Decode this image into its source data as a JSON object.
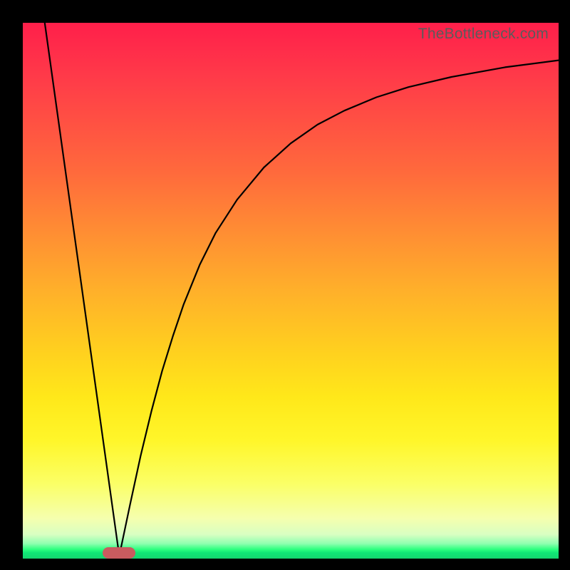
{
  "watermark": "TheBottleneck.com",
  "colors": {
    "frame": "#000000",
    "watermark_text": "#5b5b5b",
    "marker": "#c95b5f",
    "curve": "#000000",
    "gradient_top": "#ff1f4a",
    "gradient_bottom": "#14d46f"
  },
  "chart_data": {
    "type": "line",
    "title": "",
    "xlabel": "",
    "ylabel": "",
    "xlim": [
      0,
      100
    ],
    "ylim": [
      0,
      100
    ],
    "grid": false,
    "legend": false,
    "annotations": [
      {
        "kind": "marker",
        "shape": "rounded-rect",
        "color": "#c95b5f",
        "x": 18,
        "y": 0,
        "width_pct": 6.1,
        "height_pct": 2.1
      }
    ],
    "series": [
      {
        "name": "left-line",
        "x": [
          4.1,
          18.0
        ],
        "y": [
          100.0,
          0.5
        ]
      },
      {
        "name": "right-curve",
        "x": [
          18.0,
          20,
          22,
          24,
          26,
          28,
          30,
          33,
          36,
          40,
          45,
          50,
          55,
          60,
          66,
          72,
          80,
          90,
          100
        ],
        "y": [
          0.5,
          10.0,
          19.2,
          27.5,
          35.0,
          41.5,
          47.4,
          54.8,
          60.8,
          67.0,
          73.0,
          77.5,
          81.0,
          83.6,
          86.1,
          88.0,
          89.9,
          91.7,
          93.0
        ]
      }
    ],
    "background": {
      "type": "vertical-gradient",
      "description": "red at top through orange/yellow to bright green at very bottom",
      "stops": [
        {
          "pos": 0.0,
          "color": "#ff1f4a"
        },
        {
          "pos": 0.28,
          "color": "#ff6a3c"
        },
        {
          "pos": 0.5,
          "color": "#ffb02a"
        },
        {
          "pos": 0.7,
          "color": "#ffe81a"
        },
        {
          "pos": 0.9,
          "color": "#f5ffae"
        },
        {
          "pos": 0.985,
          "color": "#2cff7e"
        },
        {
          "pos": 1.0,
          "color": "#14d46f"
        }
      ]
    }
  }
}
